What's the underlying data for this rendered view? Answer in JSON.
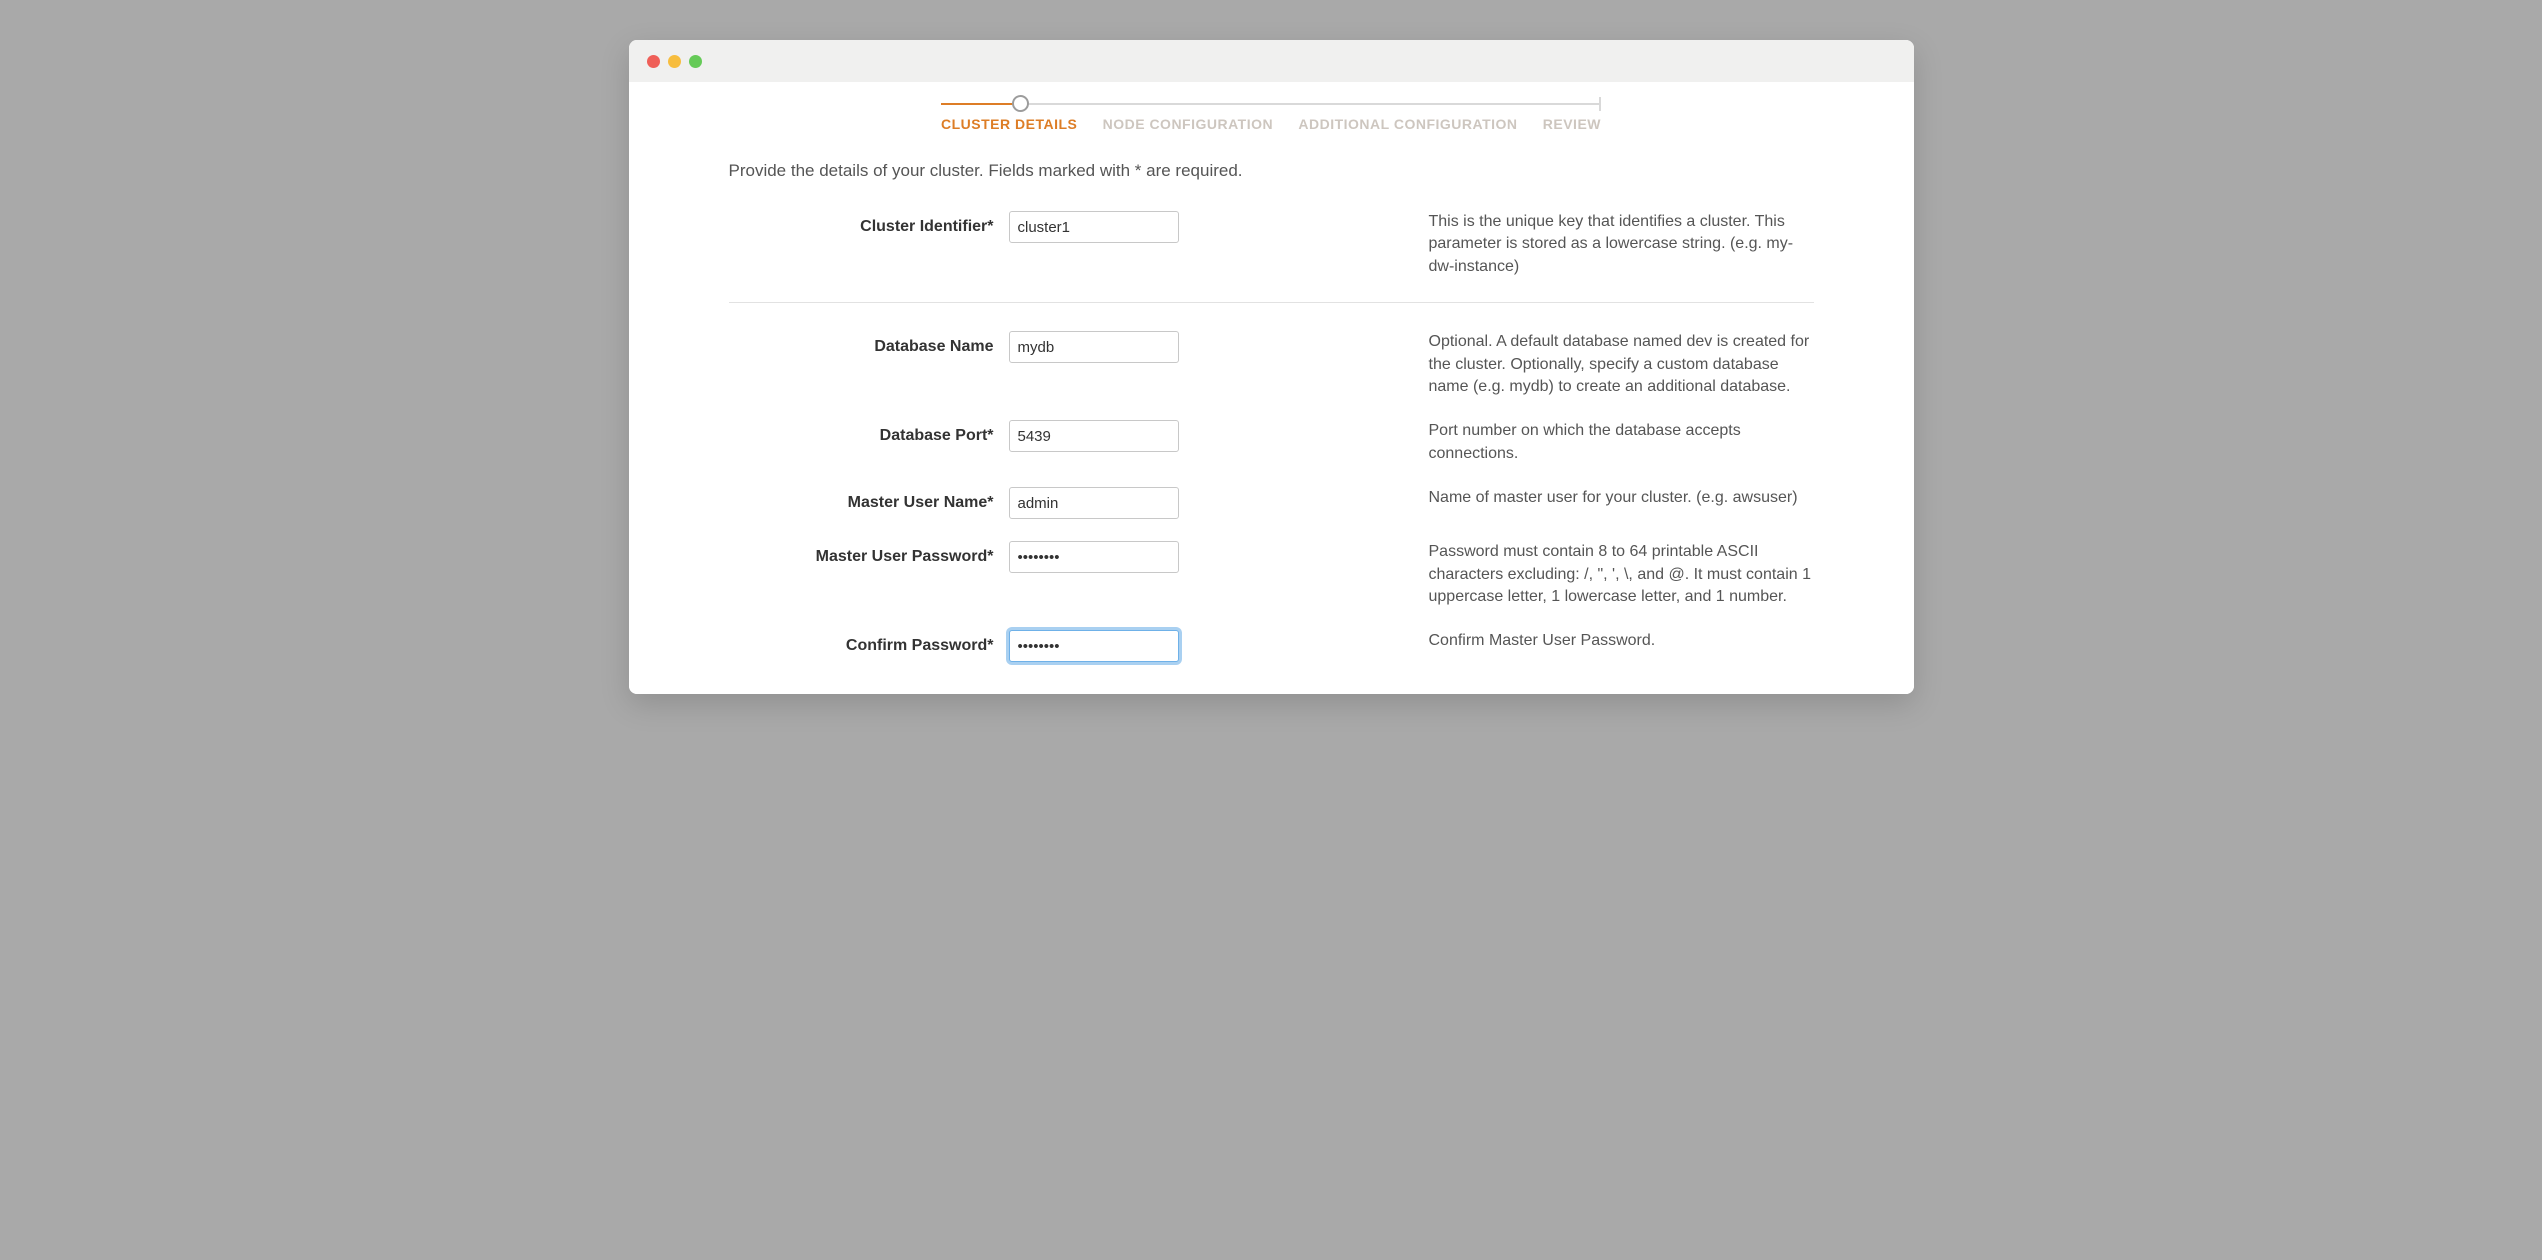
{
  "wizard": {
    "steps": [
      "CLUSTER DETAILS",
      "NODE CONFIGURATION",
      "ADDITIONAL CONFIGURATION",
      "REVIEW"
    ]
  },
  "intro": "Provide the details of your cluster. Fields marked with * are required.",
  "fields": {
    "cluster_identifier": {
      "label": "Cluster Identifier*",
      "value": "cluster1",
      "help": "This is the unique key that identifies a cluster. This parameter is stored as a lowercase string. (e.g. my-dw-instance)"
    },
    "database_name": {
      "label": "Database Name",
      "value": "mydb",
      "help": "Optional. A default database named dev is created for the cluster. Optionally, specify a custom database name (e.g. mydb) to create an additional database."
    },
    "database_port": {
      "label": "Database Port*",
      "value": "5439",
      "help": "Port number on which the database accepts connections."
    },
    "master_user_name": {
      "label": "Master User Name*",
      "value": "admin",
      "help": "Name of master user for your cluster. (e.g. awsuser)"
    },
    "master_user_password": {
      "label": "Master User Password*",
      "value": "••••••••",
      "help": "Password must contain 8 to 64 printable ASCII characters excluding: /, \", ', \\, and @. It must contain 1 uppercase letter, 1 lowercase letter, and 1 number."
    },
    "confirm_password": {
      "label": "Confirm Password*",
      "value": "••••••••",
      "help": "Confirm Master User Password."
    }
  }
}
